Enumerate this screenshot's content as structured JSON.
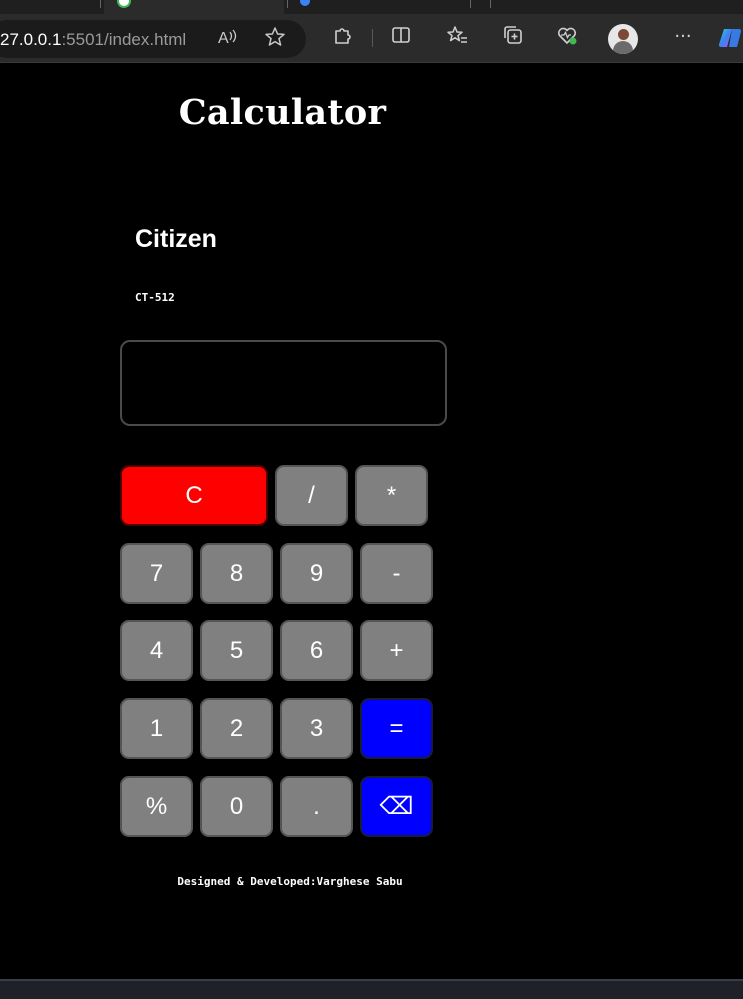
{
  "browser": {
    "url_host": "27.0.0.1",
    "url_rest": ":5501/index.html",
    "icons": [
      "read-aloud-icon",
      "favorite-star-icon",
      "extensions-icon",
      "split-screen-icon",
      "favorites-icon",
      "collections-icon",
      "browser-essentials-icon",
      "profile-avatar",
      "more-icon",
      "copilot-icon"
    ]
  },
  "page": {
    "title": "Calculator",
    "brand": "Citizen",
    "model": "CT-512",
    "display_value": "",
    "footer": "Designed & Developed:Varghese Sabu"
  },
  "keys": {
    "clear": "C",
    "divide": "/",
    "multiply": "*",
    "seven": "7",
    "eight": "8",
    "nine": "9",
    "minus": "-",
    "four": "4",
    "five": "5",
    "six": "6",
    "plus": "+",
    "one": "1",
    "two": "2",
    "three": "3",
    "equals": "=",
    "percent": "%",
    "zero": "0",
    "dot": ".",
    "backspace": "⌫"
  },
  "colors": {
    "clear_key": "#ff0000",
    "action_key": "#0000ff",
    "default_key": "#808080",
    "background": "#000000"
  }
}
